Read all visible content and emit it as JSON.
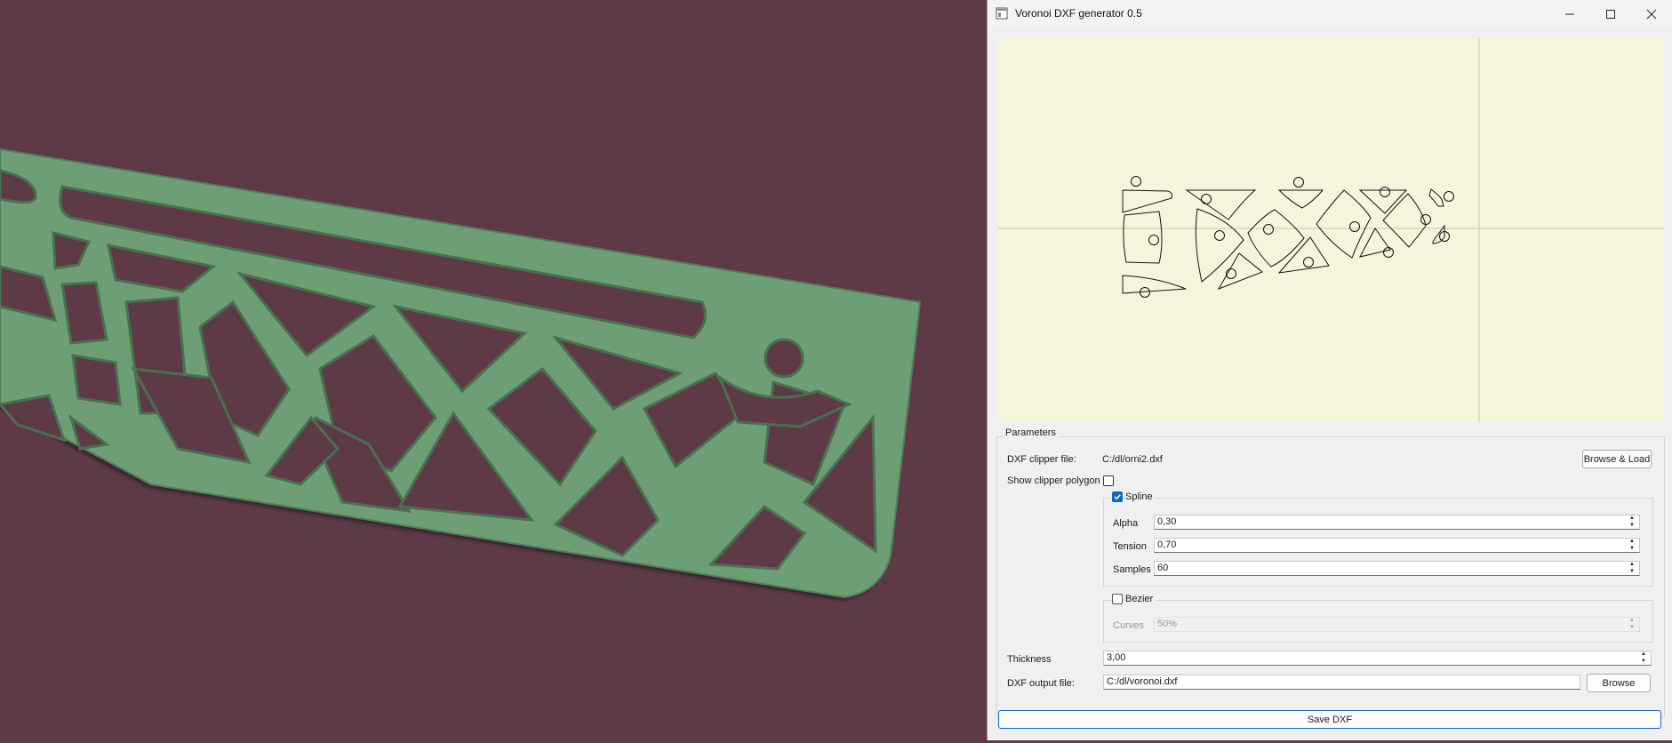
{
  "window": {
    "title": "Voronoi DXF generator 0.5",
    "icon": "app-window-icon",
    "controls": [
      "minimize-icon",
      "maximize-icon",
      "close-icon"
    ]
  },
  "preview": {
    "background": "#f5f5de",
    "crosshair": "vertical and horizontal axis lines",
    "cells": "voronoi cells with circular holes"
  },
  "parameters": {
    "group_title": "Parameters",
    "clipper_file_label": "DXF clipper file:",
    "clipper_file_value": "C:/dl/orni2.dxf",
    "browse_load_label": "Browse & Load",
    "show_clipper_label": "Show clipper polygon",
    "show_clipper_checked": false,
    "spline": {
      "label": "Spline",
      "checked": true,
      "alpha_label": "Alpha",
      "alpha_value": "0,30",
      "tension_label": "Tension",
      "tension_value": "0,70",
      "samples_label": "Samples",
      "samples_value": "60"
    },
    "bezier": {
      "label": "Bezier",
      "checked": false,
      "curves_label": "Curves",
      "curves_value": "50%"
    },
    "thickness_label": "Thickness",
    "thickness_value": "3,00",
    "output_file_label": "DXF output file:",
    "output_file_value": "C:/dl/voronoi.dxf",
    "browse_label": "Browse"
  },
  "save_label": "Save DXF",
  "colors": {
    "scene_background": "#5e3a47",
    "plate": "#6d9e76",
    "accent": "#0f66c7"
  }
}
